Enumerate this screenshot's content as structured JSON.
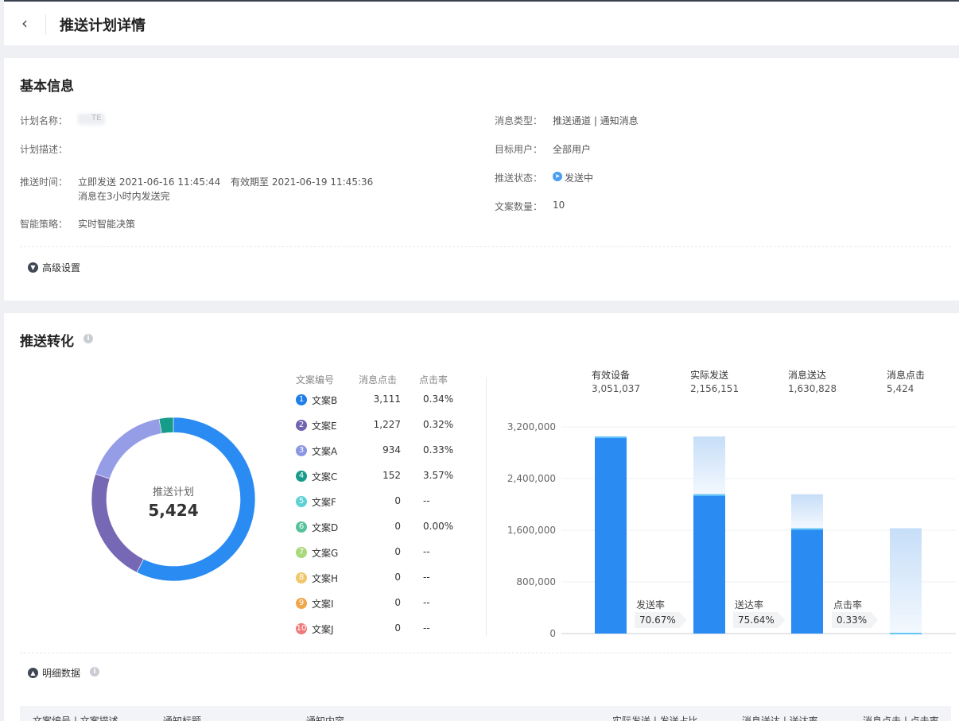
{
  "header": {
    "back_icon": "chevron-left-icon",
    "title": "推送计划详情"
  },
  "basic": {
    "title": "基本信息",
    "left": [
      {
        "label": "计划名称：",
        "value": "TE"
      },
      {
        "label": "计划描述：",
        "value": ""
      },
      {
        "label": "推送时间：",
        "value": "立即发送 2021-06-16 11:45:44",
        "value2": "有效期至 2021-06-19 11:45:36",
        "value3": "消息在3小时内发送完"
      },
      {
        "label": "智能策略：",
        "value": "实时智能决策"
      }
    ],
    "right": [
      {
        "label": "消息类型：",
        "value": "推送通道 | 通知消息"
      },
      {
        "label": "目标用户：",
        "value": "全部用户"
      },
      {
        "label": "推送状态：",
        "value": "发送中"
      },
      {
        "label": "文案数量：",
        "value": "10"
      }
    ],
    "advanced": "高级设置"
  },
  "conversion": {
    "title": "推送转化",
    "donut": {
      "label": "推送计划",
      "total": "5,424"
    },
    "table_headers": [
      "文案编号",
      "消息点击",
      "点击率"
    ],
    "rows": [
      {
        "no": "1",
        "name": "文案B",
        "clicks": "3,111",
        "rate": "0.34%",
        "color": "#1f7fe8"
      },
      {
        "no": "2",
        "name": "文案E",
        "clicks": "1,227",
        "rate": "0.32%",
        "color": "#6f64b0"
      },
      {
        "no": "3",
        "name": "文案A",
        "clicks": "934",
        "rate": "0.33%",
        "color": "#8b96e3"
      },
      {
        "no": "4",
        "name": "文案C",
        "clicks": "152",
        "rate": "3.57%",
        "color": "#159c8a"
      },
      {
        "no": "5",
        "name": "文案F",
        "clicks": "0",
        "rate": "--",
        "color": "#5fd1d6"
      },
      {
        "no": "6",
        "name": "文案D",
        "clicks": "0",
        "rate": "0.00%",
        "color": "#56c29a"
      },
      {
        "no": "7",
        "name": "文案G",
        "clicks": "0",
        "rate": "--",
        "color": "#a9d97a"
      },
      {
        "no": "8",
        "name": "文案H",
        "clicks": "0",
        "rate": "--",
        "color": "#f2c56a"
      },
      {
        "no": "9",
        "name": "文案I",
        "clicks": "0",
        "rate": "--",
        "color": "#f0a64b"
      },
      {
        "no": "10",
        "name": "文案J",
        "clicks": "0",
        "rate": "--",
        "color": "#f07a7a"
      }
    ],
    "stats": [
      {
        "label": "有效设备",
        "value": "3,051,037"
      },
      {
        "label": "实际发送",
        "value": "2,156,151"
      },
      {
        "label": "消息送达",
        "value": "1,630,828"
      },
      {
        "label": "消息点击",
        "value": "5,424"
      }
    ],
    "rates": [
      {
        "label": "发送率",
        "value": "70.67%"
      },
      {
        "label": "送达率",
        "value": "75.64%"
      },
      {
        "label": "点击率",
        "value": "0.33%"
      }
    ],
    "detail_toggle": "明细数据",
    "detail_headers": [
      "文案编号 | 文案描述",
      "通知标题",
      "通知内容",
      "实际发送 | 发送占比",
      "消息送达 | 送达率",
      "消息点击 | 点击率"
    ]
  },
  "chart_data": [
    {
      "type": "pie",
      "categories": [
        "文案B",
        "文案E",
        "文案A",
        "文案C",
        "文案F",
        "文案D",
        "文案G",
        "文案H",
        "文案I",
        "文案J"
      ],
      "values": [
        3111,
        1227,
        934,
        152,
        0,
        0,
        0,
        0,
        0,
        0
      ],
      "colors": [
        "#2a8cf3",
        "#7668b5",
        "#949de6",
        "#169d8a",
        "#5fd1d6",
        "#56c29a",
        "#a9d97a",
        "#f2c56a",
        "#f0a64b",
        "#f07a7a"
      ]
    },
    {
      "type": "bar",
      "categories": [
        "有效设备",
        "实际发送",
        "消息送达",
        "消息点击"
      ],
      "values": [
        3051037,
        2156151,
        1630828,
        5424
      ],
      "ylim": [
        0,
        3200000
      ],
      "yticks": [
        0,
        800000,
        1600000,
        2400000,
        3200000
      ],
      "ytick_labels": [
        "0",
        "800,000",
        "1,600,000",
        "2,400,000",
        "3,200,000"
      ],
      "grid": true,
      "bar_color": "#2a8cf3"
    }
  ]
}
